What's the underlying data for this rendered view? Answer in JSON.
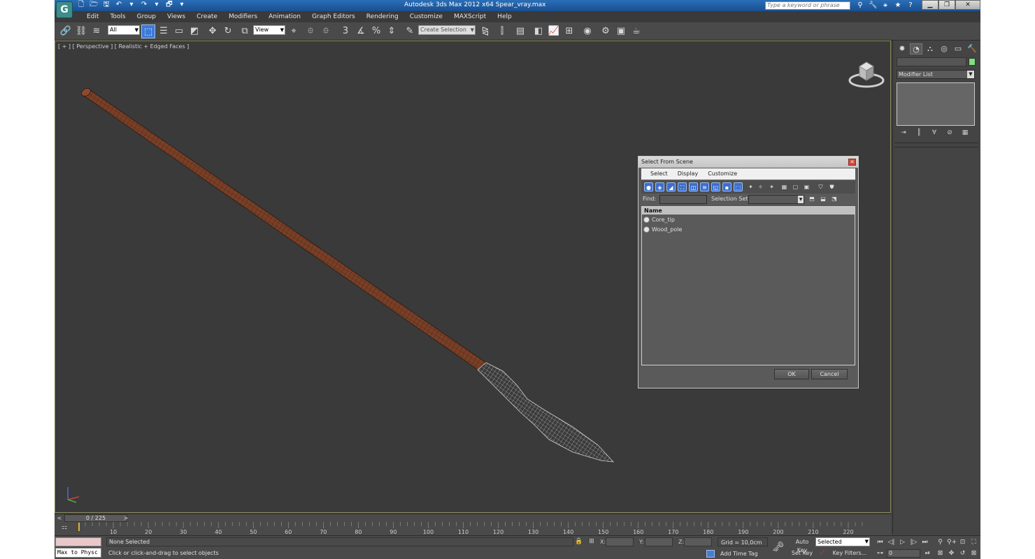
{
  "app": {
    "logo_glyph": "G",
    "title": "Autodesk 3ds Max  2012 x64      Spear_vray.max",
    "search_placeholder": "Type a keyword or phrase"
  },
  "quick_access": [
    "🗋",
    "🗁",
    "🖫",
    "↶",
    "▾",
    "↷",
    "▾",
    "🗗",
    "▾"
  ],
  "help_icons": [
    "⚲",
    "🔧",
    "⚹",
    "★",
    "?",
    "▾"
  ],
  "window_controls": [
    "▁",
    "❐",
    "✕"
  ],
  "menu": [
    "Edit",
    "Tools",
    "Group",
    "Views",
    "Create",
    "Modifiers",
    "Animation",
    "Graph Editors",
    "Rendering",
    "Customize",
    "MAXScript",
    "Help"
  ],
  "toolbar": {
    "selection_filter": "All",
    "reference_coord": "View",
    "named_selection_set": "Create Selection Se",
    "glyphs": {
      "link": "🔗",
      "unlink": "⛓",
      "bind": "≋",
      "select": "⬚",
      "select_by_name": "☰",
      "rect_region": "▭",
      "window_crossing": "◩",
      "move": "✥",
      "rotate": "↻",
      "scale": "⧉",
      "pivot": "⌖",
      "manipulate": "⯐",
      "snaps": "3",
      "angle_snap": "∡",
      "percent_snap": "%",
      "spinner_snap": "⇕",
      "edit_named_sel": "✎",
      "mirror": "⧎",
      "align": "⫿",
      "layers": "▤",
      "graphite": "◧",
      "curve_editor": "📈",
      "schematic": "⊞",
      "material_editor": "◉",
      "render_setup": "⚙",
      "rendered_frame": "▣",
      "render": "☕"
    }
  },
  "viewport": {
    "label": "[ + ] [ Perspective ] [ Realistic + Edged Faces ]"
  },
  "command_panel": {
    "tabs": [
      "✸",
      "◔",
      "⛬",
      "◎",
      "▭",
      "🔨"
    ],
    "modifier_list": "Modifier List",
    "stack_tools": [
      "⇥",
      "║",
      "∀",
      "⊘",
      "▦"
    ],
    "object_color": "#7fe07f"
  },
  "dialog": {
    "title": "Select From Scene",
    "close": "✕",
    "menu": [
      "Select",
      "Display",
      "Customize"
    ],
    "toolbar_blue": [
      "●",
      "◈",
      "◢",
      "⛶",
      "◫",
      "≋",
      "◱",
      "▪",
      "⬚"
    ],
    "toolbar_plain": [
      "✦",
      "✧",
      "✶",
      "▦",
      "▢",
      "▣",
      "⛉",
      "⛊"
    ],
    "find_label": "Find:",
    "find_value": "",
    "selection_set_label": "Selection Set:",
    "selset_buttons": [
      "⬒",
      "⬓",
      "⬔"
    ],
    "column_header": "Name",
    "objects": [
      "Core_tip",
      "Wood_pole"
    ],
    "ok": "OK",
    "cancel": "Cancel"
  },
  "time_slider": {
    "prev": "<",
    "frame": "0 / 225",
    "next": ">"
  },
  "trackbar": {
    "icon": "⚏",
    "ticks": [
      10,
      20,
      30,
      40,
      50,
      60,
      70,
      80,
      90,
      100,
      110,
      120,
      130,
      140,
      150,
      160,
      170,
      180,
      190,
      200,
      210,
      220
    ]
  },
  "status": {
    "maxscript_label": "Max to Physc",
    "selected": "None Selected",
    "prompt": "Click or click-and-drag to select objects",
    "lock_icon": "🔒",
    "abs_icon": "⊞",
    "x_label": "X:",
    "y_label": "Y:",
    "z_label": "Z:",
    "grid": "Grid = 10,0cm",
    "add_time_tag": "Add Time Tag",
    "key_icon": "🗝",
    "auto_key": "Auto Key",
    "set_key": "Set Key",
    "key_mode": "Selected",
    "key_filters": "Key Filters...",
    "key_filters_icon": "⟋",
    "current_frame": "0",
    "playback": [
      "⏮",
      "◁|",
      "▷",
      "|▷",
      "⏭"
    ],
    "playback2": [
      "⊶",
      "⏯"
    ],
    "nav": [
      "⚲",
      "⚲+",
      "⊡",
      "⛶",
      "⊠",
      "✥",
      "↺",
      "⊠"
    ]
  }
}
